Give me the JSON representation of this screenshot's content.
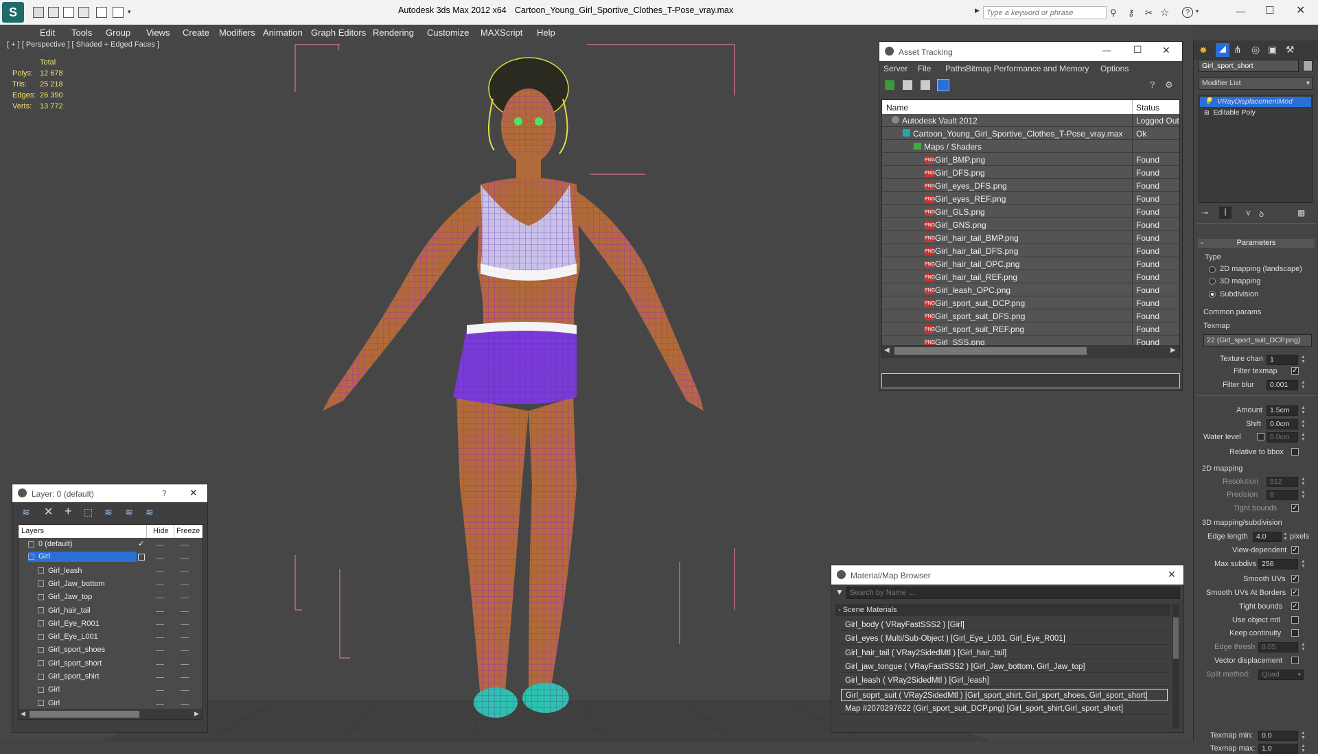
{
  "titlebar": {
    "app_title": "Autodesk 3ds Max  2012 x64",
    "file_title": "Cartoon_Young_Girl_Sportive_Clothes_T-Pose_vray.max",
    "search_placeholder": "Type a keyword or phrase"
  },
  "menu": [
    "Edit",
    "Tools",
    "Group",
    "Views",
    "Create",
    "Modifiers",
    "Animation",
    "Graph Editors",
    "Rendering",
    "Customize",
    "MAXScript",
    "Help"
  ],
  "viewport": {
    "label": "[ + ] [ Perspective ] [ Shaded + Edged Faces ]",
    "stats": {
      "header": "Total",
      "rows": [
        {
          "label": "Polys:",
          "value": "12 678"
        },
        {
          "label": "Tris:",
          "value": "25 218"
        },
        {
          "label": "Edges:",
          "value": "26 390"
        },
        {
          "label": "Verts:",
          "value": "13 772"
        }
      ]
    }
  },
  "asset_tracking": {
    "title": "Asset Tracking",
    "menu": [
      "Server",
      "File",
      "Paths",
      "Bitmap Performance and Memory",
      "Options"
    ],
    "columns": {
      "name": "Name",
      "status": "Status"
    },
    "rows": [
      {
        "name": "Autodesk Vault 2012",
        "status": "Logged Out",
        "indent": 0,
        "icon": "vault"
      },
      {
        "name": "Cartoon_Young_Girl_Sportive_Clothes_T-Pose_vray.max",
        "status": "Ok",
        "indent": 1,
        "icon": "max"
      },
      {
        "name": "Maps / Shaders",
        "status": "",
        "indent": 2,
        "icon": "folder"
      },
      {
        "name": "Girl_BMP.png",
        "status": "Found",
        "indent": 3,
        "icon": "png"
      },
      {
        "name": "Girl_DFS.png",
        "status": "Found",
        "indent": 3,
        "icon": "png"
      },
      {
        "name": "Girl_eyes_DFS.png",
        "status": "Found",
        "indent": 3,
        "icon": "png"
      },
      {
        "name": "Girl_eyes_REF.png",
        "status": "Found",
        "indent": 3,
        "icon": "png"
      },
      {
        "name": "Girl_GLS.png",
        "status": "Found",
        "indent": 3,
        "icon": "png"
      },
      {
        "name": "Girl_GNS.png",
        "status": "Found",
        "indent": 3,
        "icon": "png"
      },
      {
        "name": "Girl_hair_tail_BMP.png",
        "status": "Found",
        "indent": 3,
        "icon": "png"
      },
      {
        "name": "Girl_hair_tail_DFS.png",
        "status": "Found",
        "indent": 3,
        "icon": "png"
      },
      {
        "name": "Girl_hair_tail_OPC.png",
        "status": "Found",
        "indent": 3,
        "icon": "png"
      },
      {
        "name": "Girl_hair_tail_REF.png",
        "status": "Found",
        "indent": 3,
        "icon": "png"
      },
      {
        "name": "Girl_leash_OPC.png",
        "status": "Found",
        "indent": 3,
        "icon": "png"
      },
      {
        "name": "Girl_sport_suit_DCP.png",
        "status": "Found",
        "indent": 3,
        "icon": "png"
      },
      {
        "name": "Girl_sport_suit_DFS.png",
        "status": "Found",
        "indent": 3,
        "icon": "png"
      },
      {
        "name": "Girl_sport_suit_REF.png",
        "status": "Found",
        "indent": 3,
        "icon": "png"
      },
      {
        "name": "Girl_SSS.png",
        "status": "Found",
        "indent": 3,
        "icon": "png"
      }
    ]
  },
  "layers": {
    "title": "Layer: 0 (default)",
    "help": "?",
    "columns": {
      "layers": "Layers",
      "hide": "Hide",
      "freeze": "Freeze"
    },
    "rows": [
      {
        "name": "0 (default)",
        "indent": 1,
        "selected": false,
        "check": true
      },
      {
        "name": "Girl",
        "indent": 1,
        "selected": true,
        "check": false
      },
      {
        "name": "Girl_leash",
        "indent": 2,
        "selected": false,
        "check": false
      },
      {
        "name": "Girl_Jaw_bottom",
        "indent": 2,
        "selected": false,
        "check": false
      },
      {
        "name": "Girl_Jaw_top",
        "indent": 2,
        "selected": false,
        "check": false
      },
      {
        "name": "Girl_hair_tail",
        "indent": 2,
        "selected": false,
        "check": false
      },
      {
        "name": "Girl_Eye_R001",
        "indent": 2,
        "selected": false,
        "check": false
      },
      {
        "name": "Girl_Eye_L001",
        "indent": 2,
        "selected": false,
        "check": false
      },
      {
        "name": "Girl_sport_shoes",
        "indent": 2,
        "selected": false,
        "check": false
      },
      {
        "name": "Girl_sport_short",
        "indent": 2,
        "selected": false,
        "check": false
      },
      {
        "name": "Girl_sport_shirt",
        "indent": 2,
        "selected": false,
        "check": false
      },
      {
        "name": "Girl",
        "indent": 2,
        "selected": false,
        "check": false
      },
      {
        "name": "Girl",
        "indent": 2,
        "selected": false,
        "check": false
      }
    ]
  },
  "material_browser": {
    "title": "Material/Map Browser",
    "search_placeholder": "Search by Name ...",
    "section": "- Scene Materials",
    "rows": [
      "Girl_body  ( VRayFastSSS2 ) [Girl]",
      "Girl_eyes  ( Multi/Sub-Object ) [Girl_Eye_L001, Girl_Eye_R001]",
      "Girl_hair_tail  ( VRay2SidedMtl ) [Girl_hair_tail]",
      "Girl_jaw_tongue  ( VRayFastSSS2 ) [Girl_Jaw_bottom, Girl_Jaw_top]",
      "Girl_leash  ( VRay2SidedMtl ) [Girl_leash]",
      "Girl_soprt_suit  ( VRay2SidedMtl ) [Girl_sport_shirt, Girl_sport_shoes, Girl_sport_short]",
      "Map #2070297622 (Girl_sport_suit_DCP.png) [Girl_sport_shirt,Girl_sport_short]"
    ],
    "selected_index": 5
  },
  "command_panel": {
    "object_name": "Girl_sport_short",
    "modifier_list": "Modifier List",
    "stack": [
      "VRayDisplacementMod",
      "Editable Poly"
    ],
    "rollout": "Parameters",
    "type_label": "Type",
    "types": [
      {
        "label": "2D mapping (landscape)",
        "checked": false
      },
      {
        "label": "3D mapping",
        "checked": false
      },
      {
        "label": "Subdivision",
        "checked": true
      }
    ],
    "common_params": "Common params",
    "texmap_label": "Texmap",
    "texmap_value": "22 (Girl_sport_suit_DCP.png)",
    "texture_chan_label": "Texture chan",
    "texture_chan": "1",
    "filter_texmap_label": "Filter texmap",
    "filter_blur_label": "Filter blur",
    "filter_blur": "0.001",
    "amount_label": "Amount",
    "amount": "1.5cm",
    "shift_label": "Shift",
    "shift": "0.0cm",
    "water_level_label": "Water level",
    "water_level": "0.0cm",
    "relative_bbox_label": "Relative to bbox",
    "mapping2d": "2D mapping",
    "resolution_label": "Resolution",
    "resolution": "512",
    "precision_label": "Precision",
    "precision": "8",
    "tight_bounds_label": "Tight bounds",
    "mapping3d": "3D mapping/subdivision",
    "edge_length_label": "Edge length",
    "edge_length": "4.0",
    "pixels": "pixels",
    "view_dependent": "View-dependent",
    "max_subdivs_label": "Max subdivs",
    "max_subdivs": "256",
    "smooth_uvs": "Smooth UVs",
    "smooth_uvs_borders": "Smooth UVs At Borders",
    "tight_bounds2": "Tight bounds",
    "use_object_mtl": "Use object mtl",
    "keep_continuity": "Keep continuity",
    "edge_thresh_label": "Edge thresh",
    "edge_thresh": "0.05",
    "vector_disp": "Vector displacement",
    "split_method_label": "Split method:",
    "split_method": "Quad",
    "texmap_min_label": "Texmap min:",
    "texmap_min": "0.0",
    "texmap_max_label": "Texmap max:",
    "texmap_max": "1.0"
  },
  "colors": {
    "accent": "#2a6fd6",
    "wire": "#b020c0",
    "skin": "#b06a3c",
    "hair": "#e0e040",
    "shoes": "#30c0b0",
    "outfit": "#7a3ad8"
  }
}
